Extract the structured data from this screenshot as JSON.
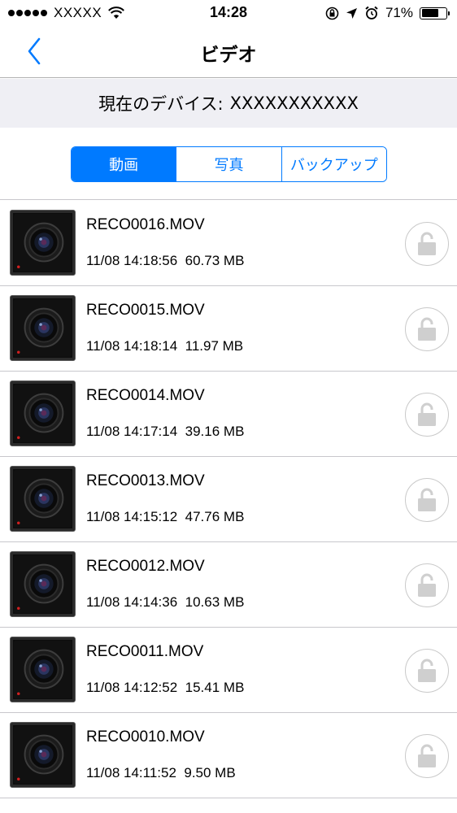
{
  "status_bar": {
    "carrier": "XXXXX",
    "time": "14:28",
    "battery_percent": "71%",
    "battery_level": 0.71
  },
  "nav": {
    "title": "ビデオ",
    "back_icon": "chevron-left-icon"
  },
  "device": {
    "label": "現在のデバイス:",
    "name": "XXXXXXXXXXX"
  },
  "tabs": [
    {
      "label": "動画",
      "active": true
    },
    {
      "label": "写真",
      "active": false
    },
    {
      "label": "バックアップ",
      "active": false
    }
  ],
  "accent_color": "#007aff",
  "files": [
    {
      "name": "RECO0016.MOV",
      "datetime": "11/08 14:18:56",
      "size": "60.73 MB",
      "locked": false
    },
    {
      "name": "RECO0015.MOV",
      "datetime": "11/08 14:18:14",
      "size": "11.97 MB",
      "locked": false
    },
    {
      "name": "RECO0014.MOV",
      "datetime": "11/08 14:17:14",
      "size": "39.16 MB",
      "locked": false
    },
    {
      "name": "RECO0013.MOV",
      "datetime": "11/08 14:15:12",
      "size": "47.76 MB",
      "locked": false
    },
    {
      "name": "RECO0012.MOV",
      "datetime": "11/08 14:14:36",
      "size": "10.63 MB",
      "locked": false
    },
    {
      "name": "RECO0011.MOV",
      "datetime": "11/08 14:12:52",
      "size": "15.41 MB",
      "locked": false
    },
    {
      "name": "RECO0010.MOV",
      "datetime": "11/08 14:11:52",
      "size": "9.50 MB",
      "locked": false
    }
  ]
}
